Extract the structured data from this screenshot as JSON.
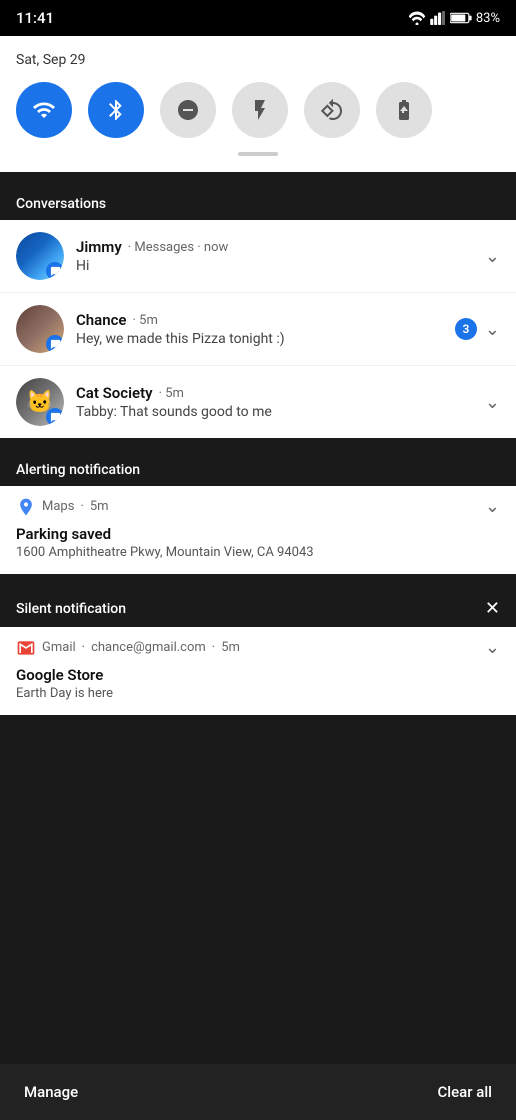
{
  "statusBar": {
    "time": "11:41",
    "battery": "83%"
  },
  "quickSettings": {
    "date": "Sat, Sep 29",
    "buttons": [
      {
        "id": "wifi",
        "label": "Wi-Fi",
        "active": true
      },
      {
        "id": "bluetooth",
        "label": "Bluetooth",
        "active": true
      },
      {
        "id": "dnd",
        "label": "Do Not Disturb",
        "active": false
      },
      {
        "id": "flashlight",
        "label": "Flashlight",
        "active": false
      },
      {
        "id": "rotate",
        "label": "Auto Rotate",
        "active": false
      },
      {
        "id": "battery-saver",
        "label": "Battery Saver",
        "active": false
      }
    ]
  },
  "conversations": {
    "sectionLabel": "Conversations",
    "items": [
      {
        "name": "Jimmy",
        "app": "Messages",
        "time": "now",
        "message": "Hi",
        "badge": null,
        "avatarType": "jimmy"
      },
      {
        "name": "Chance",
        "app": null,
        "time": "5m",
        "message": "Hey, we made this Pizza tonight :)",
        "badge": "3",
        "avatarType": "chance"
      },
      {
        "name": "Cat Society",
        "app": null,
        "time": "5m",
        "message": "Tabby: That sounds good to me",
        "badge": null,
        "avatarType": "cat"
      }
    ]
  },
  "alertingNotification": {
    "sectionLabel": "Alerting notification",
    "app": "Maps",
    "time": "5m",
    "title": "Parking saved",
    "text": "1600 Amphitheatre Pkwy, Mountain View, CA 94043"
  },
  "silentNotification": {
    "sectionLabel": "Silent notification",
    "app": "Gmail",
    "email": "chance@gmail.com",
    "time": "5m",
    "title": "Google Store",
    "text": "Earth Day is here"
  },
  "bottomBar": {
    "manageLabel": "Manage",
    "clearAllLabel": "Clear all"
  }
}
